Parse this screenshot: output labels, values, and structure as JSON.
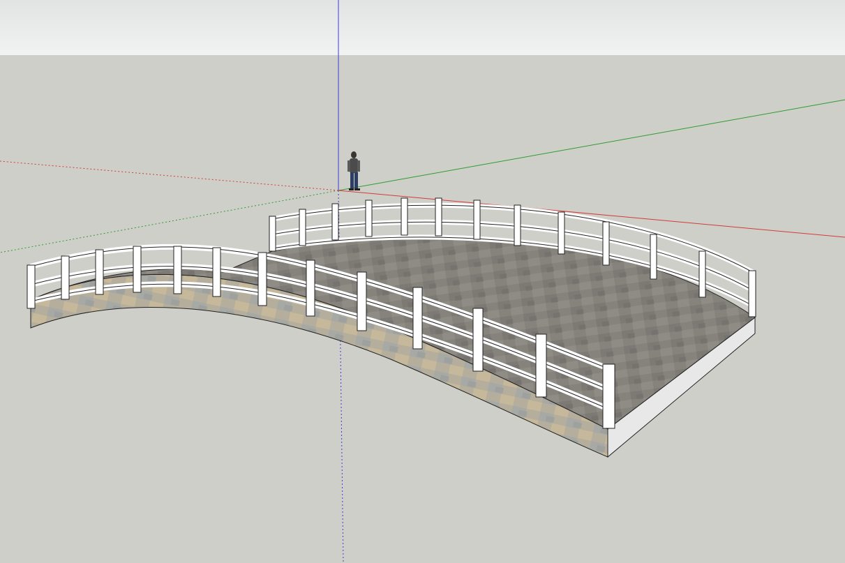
{
  "scene": {
    "sky_color_top": "#e2e3e3",
    "sky_color_bottom": "#f1f2f2",
    "ground_color": "#cfcfca",
    "axis_colors": {
      "red": "#d33a3a",
      "green": "#2f9a2f",
      "blue": "#3b3bd8"
    },
    "colors": {
      "paving": "#8a8680",
      "paving_dark": "#6f6c67",
      "wall_front": "#b9b1a0",
      "wall_side": "#e9e9e9",
      "fence": "#ffffff",
      "fence_outline": "#2a2a2a"
    },
    "objects": {
      "bridge": "bridge-model",
      "figure": "scale-figure-person"
    }
  }
}
